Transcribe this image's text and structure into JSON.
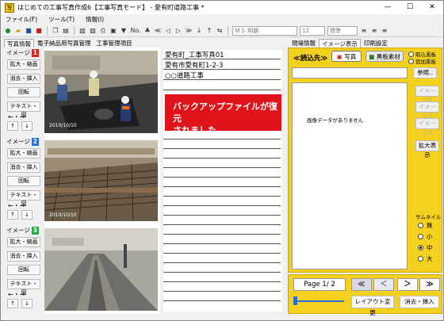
{
  "window": {
    "title": "はじめての工事写真作成6【工事写真モード】 - 愛有町道路工事 *",
    "app_icon": "app-icon"
  },
  "menu": [
    "ファイル(F)",
    "ツール(T)",
    "情報(I)"
  ],
  "toolbar": {
    "number_label": "No.",
    "font_value": "ＭＳ 明朝",
    "size_value": "12",
    "style_value": "標準"
  },
  "left_tabs": [
    "写真情報",
    "電子納品用写真管理",
    "工事管理項目"
  ],
  "images": [
    {
      "label": "イメージ",
      "num": "1",
      "color": "#e02020"
    },
    {
      "label": "イメージ",
      "num": "2",
      "color": "#2a6fd8"
    },
    {
      "label": "イメージ",
      "num": "3",
      "color": "#2aa84a"
    }
  ],
  "buttons": {
    "zoom": "拡大・縮画",
    "erase_insert": "消去・挿入",
    "rotate": "回転",
    "text": "テキスト・図",
    "arrows_lr": "←・→",
    "up": "↑",
    "down": "↓"
  },
  "photo_timestamps": [
    "2010/10/10",
    "2010/10/10",
    ""
  ],
  "entries": {
    "line1": "愛有町_工事写真01",
    "line2": "愛有市愛有町1-2-3",
    "line3": "○○道路工事"
  },
  "toast": {
    "line1": "バックアップファイルが復元",
    "line2": "されました"
  },
  "right_tabs": [
    "現場情報",
    "イメージ表示",
    "印刷設定"
  ],
  "right": {
    "header": "≪読込先≫",
    "photo_btn": "写真",
    "material_btn": "黒板素材",
    "opt1": "取込黒板",
    "opt2": "追加黒板",
    "ref_btn": "参照..",
    "no_image": "画像データがありません",
    "img_btns": [
      "イメージ1",
      "イメージ2",
      "イメージ3"
    ],
    "enlarge": "拡大表示",
    "thumb_label": "サムネイル",
    "sizes": [
      "無",
      "小",
      "中",
      "大"
    ],
    "selected_size": "中"
  },
  "bottom": {
    "page": "Page  1/ 2",
    "layout_btn": "レイアウト変更",
    "erase_btn": "消去・挿入"
  }
}
